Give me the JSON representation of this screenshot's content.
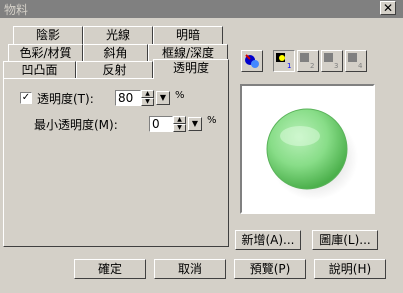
{
  "window": {
    "title": "物料",
    "close_glyph": "✕"
  },
  "tabs": {
    "row1": [
      "陰影",
      "光線",
      "明暗"
    ],
    "row2": [
      "色彩/材質",
      "斜角",
      "框線/深度"
    ],
    "row3": [
      "凹凸面",
      "反射",
      "透明度"
    ]
  },
  "transparency": {
    "checkbox_label": "透明度(T):",
    "checked": true,
    "value": "80",
    "unit": "%",
    "min_label": "最小透明度(M):",
    "min_value": "0",
    "min_unit": "%"
  },
  "toolbar_icons": [
    "material-icon",
    "light-1-icon",
    "light-2-icon",
    "light-3-icon",
    "light-4-icon"
  ],
  "buttons": {
    "new": "新增(A)...",
    "library": "圖庫(L)...",
    "ok": "確定",
    "cancel": "取消",
    "preview": "預覽(P)",
    "help": "說明(H)"
  },
  "colors": {
    "sphere": "#66cc66",
    "titlebar": "#808080"
  }
}
